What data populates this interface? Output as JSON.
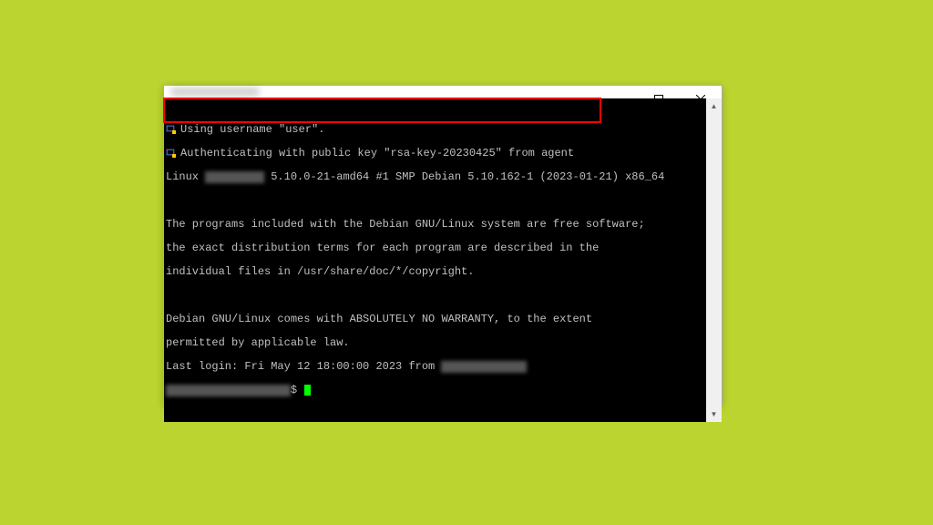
{
  "window": {
    "title_redacted": "XXXXXXXXXXXX"
  },
  "controls": {
    "minimize": "minimize-button",
    "maximize": "maximize-button",
    "close": "close-button"
  },
  "terminal": {
    "auth_line1": "Using username \"user\".",
    "auth_line2": "Authenticating with public key \"rsa-key-20230425\" from agent",
    "kernel_prefix": "Linux ",
    "kernel_redacted": "XXXXXXXXX",
    "kernel_suffix": " 5.10.0-21-amd64 #1 SMP Debian 5.10.162-1 (2023-01-21) x86_64",
    "motd1": "The programs included with the Debian GNU/Linux system are free software;",
    "motd2": "the exact distribution terms for each program are described in the",
    "motd3": "individual files in /usr/share/doc/*/copyright.",
    "motd4": "Debian GNU/Linux comes with ABSOLUTELY NO WARRANTY, to the extent",
    "motd5": "permitted by applicable law.",
    "lastlogin_prefix": "Last login: Fri May 12 18:00:00 2023 from ",
    "lastlogin_redacted": "XXXXXXXXXXXXX",
    "prompt_redacted": "XXXXXXXXXXXXXXXXXXX",
    "prompt_suffix": "$ "
  }
}
